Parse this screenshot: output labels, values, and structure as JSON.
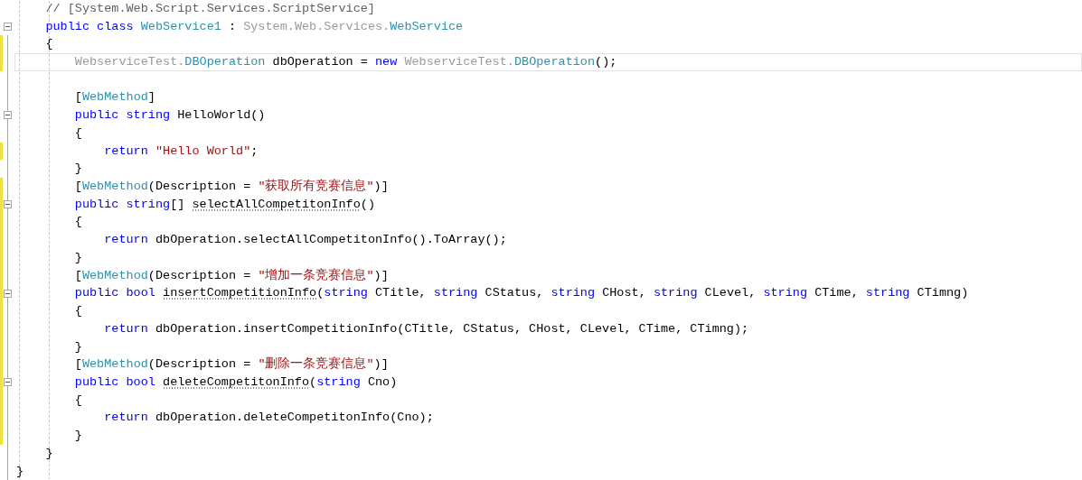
{
  "editor": {
    "lines": [
      {
        "fold": false,
        "changed": false,
        "current": false,
        "tokens": [
          {
            "kind": "comment",
            "text": "    // [System.Web.Script.Services.ScriptService]"
          }
        ]
      },
      {
        "fold": true,
        "changed": false,
        "current": false,
        "tokens": [
          {
            "kind": "keyword",
            "text": "    public class "
          },
          {
            "kind": "type",
            "text": "WebService1"
          },
          {
            "kind": "plain",
            "text": " : "
          },
          {
            "kind": "dim",
            "text": "System.Web.Services."
          },
          {
            "kind": "type",
            "text": "WebService"
          }
        ]
      },
      {
        "fold": false,
        "changed": true,
        "current": false,
        "tokens": [
          {
            "kind": "plain",
            "text": "    {"
          }
        ]
      },
      {
        "fold": false,
        "changed": true,
        "current": true,
        "tokens": [
          {
            "kind": "dim",
            "text": "        WebserviceTest."
          },
          {
            "kind": "type",
            "text": "DBOperation"
          },
          {
            "kind": "plain",
            "text": " dbOperation = "
          },
          {
            "kind": "keyword",
            "text": "new "
          },
          {
            "kind": "dim",
            "text": "WebserviceTest."
          },
          {
            "kind": "type",
            "text": "DBOperation"
          },
          {
            "kind": "plain",
            "text": "();"
          }
        ]
      },
      {
        "fold": false,
        "changed": false,
        "current": false
      },
      {
        "fold": false,
        "changed": false,
        "current": false,
        "tokens": [
          {
            "kind": "plain",
            "text": "        ["
          },
          {
            "kind": "type",
            "text": "WebMethod"
          },
          {
            "kind": "plain",
            "text": "]"
          }
        ]
      },
      {
        "fold": true,
        "changed": false,
        "current": false,
        "tokens": [
          {
            "kind": "keyword",
            "text": "        public string "
          },
          {
            "kind": "plain",
            "text": "HelloWorld()"
          }
        ]
      },
      {
        "fold": false,
        "changed": false,
        "current": false,
        "tokens": [
          {
            "kind": "plain",
            "text": "        {"
          }
        ]
      },
      {
        "fold": false,
        "changed": true,
        "current": false,
        "tokens": [
          {
            "kind": "keyword",
            "text": "            return "
          },
          {
            "kind": "string",
            "text": "\"Hello World\""
          },
          {
            "kind": "plain",
            "text": ";"
          }
        ]
      },
      {
        "fold": false,
        "changed": false,
        "current": false,
        "tokens": [
          {
            "kind": "plain",
            "text": "        }"
          }
        ]
      },
      {
        "fold": false,
        "changed": true,
        "current": false,
        "tokens": [
          {
            "kind": "plain",
            "text": "        ["
          },
          {
            "kind": "type",
            "text": "WebMethod"
          },
          {
            "kind": "plain",
            "text": "(Description = "
          },
          {
            "kind": "string",
            "text": "\"获取所有竞赛信息\""
          },
          {
            "kind": "plain",
            "text": ")]"
          }
        ]
      },
      {
        "fold": true,
        "changed": true,
        "current": false,
        "tokens": [
          {
            "kind": "keyword",
            "text": "        public string"
          },
          {
            "kind": "plain",
            "text": "[] "
          },
          {
            "kind": "plain",
            "text": "selectAllCompetitonInfo",
            "suggestion": true
          },
          {
            "kind": "plain",
            "text": "()"
          }
        ]
      },
      {
        "fold": false,
        "changed": true,
        "current": false,
        "tokens": [
          {
            "kind": "plain",
            "text": "        {"
          }
        ]
      },
      {
        "fold": false,
        "changed": true,
        "current": false,
        "tokens": [
          {
            "kind": "keyword",
            "text": "            return "
          },
          {
            "kind": "plain",
            "text": "dbOperation.selectAllCompetitonInfo().ToArray();"
          }
        ]
      },
      {
        "fold": false,
        "changed": true,
        "current": false,
        "tokens": [
          {
            "kind": "plain",
            "text": "        }"
          }
        ]
      },
      {
        "fold": false,
        "changed": true,
        "current": false,
        "tokens": [
          {
            "kind": "plain",
            "text": "        ["
          },
          {
            "kind": "type",
            "text": "WebMethod"
          },
          {
            "kind": "plain",
            "text": "(Description = "
          },
          {
            "kind": "string",
            "text": "\"增加一条竞赛信息\""
          },
          {
            "kind": "plain",
            "text": ")]"
          }
        ]
      },
      {
        "fold": true,
        "changed": true,
        "current": false,
        "tokens": [
          {
            "kind": "keyword",
            "text": "        public bool "
          },
          {
            "kind": "plain",
            "text": "insertCompetitionInfo",
            "suggestion": true
          },
          {
            "kind": "plain",
            "text": "("
          },
          {
            "kind": "keyword",
            "text": "string "
          },
          {
            "kind": "plain",
            "text": "CTitle, "
          },
          {
            "kind": "keyword",
            "text": "string "
          },
          {
            "kind": "plain",
            "text": "CStatus, "
          },
          {
            "kind": "keyword",
            "text": "string "
          },
          {
            "kind": "plain",
            "text": "CHost, "
          },
          {
            "kind": "keyword",
            "text": "string "
          },
          {
            "kind": "plain",
            "text": "CLevel, "
          },
          {
            "kind": "keyword",
            "text": "string "
          },
          {
            "kind": "plain",
            "text": "CTime, "
          },
          {
            "kind": "keyword",
            "text": "string "
          },
          {
            "kind": "plain",
            "text": "CTimng)"
          }
        ]
      },
      {
        "fold": false,
        "changed": true,
        "current": false,
        "tokens": [
          {
            "kind": "plain",
            "text": "        {"
          }
        ]
      },
      {
        "fold": false,
        "changed": true,
        "current": false,
        "tokens": [
          {
            "kind": "keyword",
            "text": "            return "
          },
          {
            "kind": "plain",
            "text": "dbOperation.insertCompetitionInfo(CTitle, CStatus, CHost, CLevel, CTime, CTimng);"
          }
        ]
      },
      {
        "fold": false,
        "changed": true,
        "current": false,
        "tokens": [
          {
            "kind": "plain",
            "text": "        }"
          }
        ]
      },
      {
        "fold": false,
        "changed": true,
        "current": false,
        "tokens": [
          {
            "kind": "plain",
            "text": "        ["
          },
          {
            "kind": "type",
            "text": "WebMethod"
          },
          {
            "kind": "plain",
            "text": "(Description = "
          },
          {
            "kind": "string",
            "text": "\"删除一条竞赛信息\""
          },
          {
            "kind": "plain",
            "text": ")]"
          }
        ]
      },
      {
        "fold": true,
        "changed": true,
        "current": false,
        "tokens": [
          {
            "kind": "keyword",
            "text": "        public bool "
          },
          {
            "kind": "plain",
            "text": "deleteCompetitonInfo",
            "suggestion": true
          },
          {
            "kind": "plain",
            "text": "("
          },
          {
            "kind": "keyword",
            "text": "string "
          },
          {
            "kind": "plain",
            "text": "Cno)"
          }
        ]
      },
      {
        "fold": false,
        "changed": true,
        "current": false,
        "tokens": [
          {
            "kind": "plain",
            "text": "        {"
          }
        ]
      },
      {
        "fold": false,
        "changed": true,
        "current": false,
        "tokens": [
          {
            "kind": "keyword",
            "text": "            return "
          },
          {
            "kind": "plain",
            "text": "dbOperation.deleteCompetitonInfo(Cno);"
          }
        ]
      },
      {
        "fold": false,
        "changed": true,
        "current": false,
        "tokens": [
          {
            "kind": "plain",
            "text": "        }"
          }
        ]
      },
      {
        "fold": false,
        "changed": false,
        "current": false,
        "tokens": [
          {
            "kind": "plain",
            "text": "    }"
          }
        ]
      },
      {
        "fold": false,
        "changed": false,
        "current": false,
        "tokens": [
          {
            "kind": "plain",
            "text": "}"
          }
        ]
      }
    ]
  }
}
